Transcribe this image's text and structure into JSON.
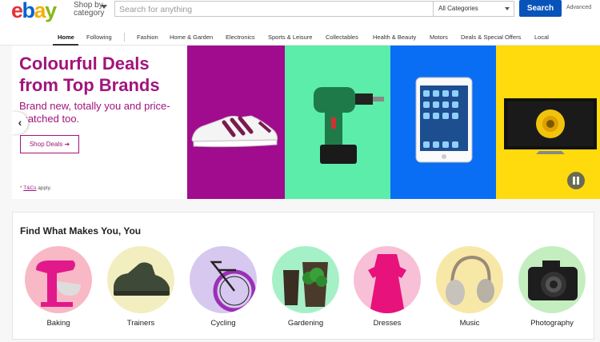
{
  "header": {
    "logo": [
      "e",
      "b",
      "a",
      "y"
    ],
    "shop_by_line1": "Shop by",
    "shop_by_line2": "category",
    "search_placeholder": "Search for anything",
    "category_select": "All Categories",
    "search_button": "Search",
    "advanced": "Advanced"
  },
  "nav": {
    "items": [
      "Home",
      "Following",
      "Fashion",
      "Home & Garden",
      "Electronics",
      "Sports & Leisure",
      "Collectables",
      "Health & Beauty",
      "Motors",
      "Deals & Special Offers",
      "Local"
    ],
    "active": "Home"
  },
  "hero": {
    "title": "Colourful Deals from Top Brands",
    "subtitle": "Brand new, totally you and price-matched too.",
    "cta": "Shop Deals",
    "terms_prefix": "* ",
    "terms_link": "T&Cs",
    "terms_suffix": " apply.",
    "colors": [
      "#a10b8e",
      "#5beda9",
      "#0a6ef5",
      "#ffdb0e"
    ]
  },
  "find": {
    "title": "Find What Makes You, You",
    "categories": [
      {
        "label": "Baking",
        "bg": "#f9b8c6"
      },
      {
        "label": "Trainers",
        "bg": "#f2eec0"
      },
      {
        "label": "Cycling",
        "bg": "#d6c8ef"
      },
      {
        "label": "Gardening",
        "bg": "#a6f0c8"
      },
      {
        "label": "Dresses",
        "bg": "#f7c0d6"
      },
      {
        "label": "Music",
        "bg": "#f7e8a8"
      },
      {
        "label": "Photography",
        "bg": "#c5eec0"
      }
    ]
  }
}
